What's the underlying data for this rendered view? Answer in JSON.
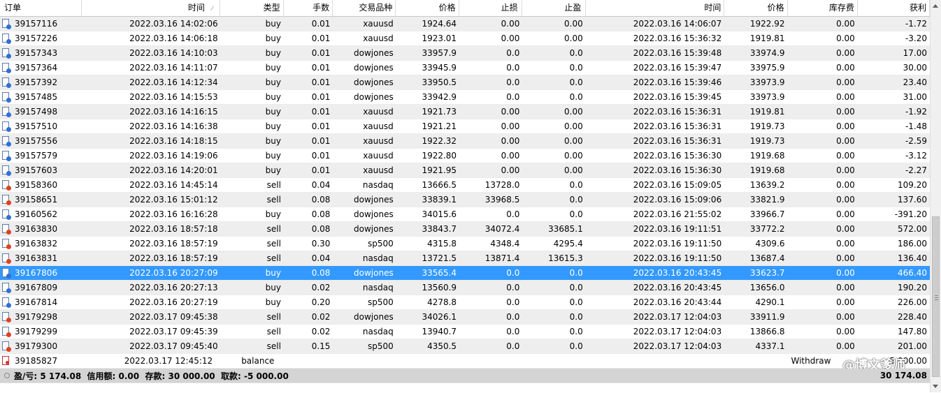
{
  "columns": {
    "order": "订单",
    "time": "时间",
    "type": "类型",
    "lots": "手数",
    "symbol": "交易品种",
    "price": "价格",
    "sl": "止损",
    "tp": "止盈",
    "close_time": "时间",
    "close_price": "价格",
    "swap": "库存费",
    "profit": "获利"
  },
  "rows": [
    {
      "order": "39157116",
      "time": "2022.03.16 14:02:06",
      "type": "buy",
      "lots": "0.01",
      "symbol": "xauusd",
      "price": "1924.64",
      "sl": "0.00",
      "tp": "0.00",
      "close_time": "2022.03.16 14:06:07",
      "close_price": "1922.92",
      "swap": "0.00",
      "profit": "-1.72"
    },
    {
      "order": "39157226",
      "time": "2022.03.16 14:06:18",
      "type": "buy",
      "lots": "0.01",
      "symbol": "xauusd",
      "price": "1923.01",
      "sl": "0.00",
      "tp": "0.00",
      "close_time": "2022.03.16 15:36:32",
      "close_price": "1919.81",
      "swap": "0.00",
      "profit": "-3.20"
    },
    {
      "order": "39157343",
      "time": "2022.03.16 14:10:03",
      "type": "buy",
      "lots": "0.01",
      "symbol": "dowjones",
      "price": "33957.9",
      "sl": "0.0",
      "tp": "0.0",
      "close_time": "2022.03.16 15:39:48",
      "close_price": "33974.9",
      "swap": "0.00",
      "profit": "17.00"
    },
    {
      "order": "39157364",
      "time": "2022.03.16 14:11:07",
      "type": "buy",
      "lots": "0.01",
      "symbol": "dowjones",
      "price": "33945.9",
      "sl": "0.0",
      "tp": "0.0",
      "close_time": "2022.03.16 15:39:47",
      "close_price": "33975.9",
      "swap": "0.00",
      "profit": "30.00"
    },
    {
      "order": "39157392",
      "time": "2022.03.16 14:12:34",
      "type": "buy",
      "lots": "0.01",
      "symbol": "dowjones",
      "price": "33950.5",
      "sl": "0.0",
      "tp": "0.0",
      "close_time": "2022.03.16 15:39:46",
      "close_price": "33973.9",
      "swap": "0.00",
      "profit": "23.40"
    },
    {
      "order": "39157485",
      "time": "2022.03.16 14:15:53",
      "type": "buy",
      "lots": "0.01",
      "symbol": "dowjones",
      "price": "33942.9",
      "sl": "0.0",
      "tp": "0.0",
      "close_time": "2022.03.16 15:39:45",
      "close_price": "33973.9",
      "swap": "0.00",
      "profit": "31.00"
    },
    {
      "order": "39157498",
      "time": "2022.03.16 14:16:15",
      "type": "buy",
      "lots": "0.01",
      "symbol": "xauusd",
      "price": "1921.73",
      "sl": "0.00",
      "tp": "0.00",
      "close_time": "2022.03.16 15:36:31",
      "close_price": "1919.81",
      "swap": "0.00",
      "profit": "-1.92"
    },
    {
      "order": "39157510",
      "time": "2022.03.16 14:16:38",
      "type": "buy",
      "lots": "0.01",
      "symbol": "xauusd",
      "price": "1921.21",
      "sl": "0.00",
      "tp": "0.00",
      "close_time": "2022.03.16 15:36:31",
      "close_price": "1919.73",
      "swap": "0.00",
      "profit": "-1.48"
    },
    {
      "order": "39157556",
      "time": "2022.03.16 14:18:15",
      "type": "buy",
      "lots": "0.01",
      "symbol": "xauusd",
      "price": "1922.32",
      "sl": "0.00",
      "tp": "0.00",
      "close_time": "2022.03.16 15:36:31",
      "close_price": "1919.73",
      "swap": "0.00",
      "profit": "-2.59"
    },
    {
      "order": "39157579",
      "time": "2022.03.16 14:19:06",
      "type": "buy",
      "lots": "0.01",
      "symbol": "xauusd",
      "price": "1922.80",
      "sl": "0.00",
      "tp": "0.00",
      "close_time": "2022.03.16 15:36:30",
      "close_price": "1919.68",
      "swap": "0.00",
      "profit": "-3.12"
    },
    {
      "order": "39157603",
      "time": "2022.03.16 14:20:01",
      "type": "buy",
      "lots": "0.01",
      "symbol": "xauusd",
      "price": "1921.95",
      "sl": "0.00",
      "tp": "0.00",
      "close_time": "2022.03.16 15:36:30",
      "close_price": "1919.68",
      "swap": "0.00",
      "profit": "-2.27"
    },
    {
      "order": "39158360",
      "time": "2022.03.16 14:45:14",
      "type": "sell",
      "lots": "0.04",
      "symbol": "nasdaq",
      "price": "13666.5",
      "sl": "13728.0",
      "tp": "0.0",
      "close_time": "2022.03.16 15:09:05",
      "close_price": "13639.2",
      "swap": "0.00",
      "profit": "109.20"
    },
    {
      "order": "39158651",
      "time": "2022.03.16 15:01:12",
      "type": "sell",
      "lots": "0.08",
      "symbol": "dowjones",
      "price": "33839.1",
      "sl": "33968.5",
      "tp": "0.0",
      "close_time": "2022.03.16 15:09:06",
      "close_price": "33821.9",
      "swap": "0.00",
      "profit": "137.60"
    },
    {
      "order": "39160562",
      "time": "2022.03.16 16:16:28",
      "type": "buy",
      "lots": "0.08",
      "symbol": "dowjones",
      "price": "34015.6",
      "sl": "0.0",
      "tp": "0.0",
      "close_time": "2022.03.16 21:55:02",
      "close_price": "33966.7",
      "swap": "0.00",
      "profit": "-391.20"
    },
    {
      "order": "39163830",
      "time": "2022.03.16 18:57:18",
      "type": "sell",
      "lots": "0.08",
      "symbol": "dowjones",
      "price": "33843.7",
      "sl": "34072.4",
      "tp": "33685.1",
      "close_time": "2022.03.16 19:11:51",
      "close_price": "33772.2",
      "swap": "0.00",
      "profit": "572.00"
    },
    {
      "order": "39163832",
      "time": "2022.03.16 18:57:19",
      "type": "sell",
      "lots": "0.30",
      "symbol": "sp500",
      "price": "4315.8",
      "sl": "4348.4",
      "tp": "4295.4",
      "close_time": "2022.03.16 19:11:50",
      "close_price": "4309.6",
      "swap": "0.00",
      "profit": "186.00"
    },
    {
      "order": "39163831",
      "time": "2022.03.16 18:57:19",
      "type": "sell",
      "lots": "0.04",
      "symbol": "nasdaq",
      "price": "13721.5",
      "sl": "13871.4",
      "tp": "13615.3",
      "close_time": "2022.03.16 19:11:50",
      "close_price": "13687.4",
      "swap": "0.00",
      "profit": "136.40"
    },
    {
      "order": "39167806",
      "time": "2022.03.16 20:27:09",
      "type": "buy",
      "lots": "0.08",
      "symbol": "dowjones",
      "price": "33565.4",
      "sl": "0.0",
      "tp": "0.0",
      "close_time": "2022.03.16 20:43:45",
      "close_price": "33623.7",
      "swap": "0.00",
      "profit": "466.40"
    },
    {
      "order": "39167809",
      "time": "2022.03.16 20:27:13",
      "type": "buy",
      "lots": "0.02",
      "symbol": "nasdaq",
      "price": "13560.9",
      "sl": "0.0",
      "tp": "0.0",
      "close_time": "2022.03.16 20:43:45",
      "close_price": "13656.0",
      "swap": "0.00",
      "profit": "190.20"
    },
    {
      "order": "39167814",
      "time": "2022.03.16 20:27:19",
      "type": "buy",
      "lots": "0.20",
      "symbol": "sp500",
      "price": "4278.8",
      "sl": "0.0",
      "tp": "0.0",
      "close_time": "2022.03.16 20:43:44",
      "close_price": "4290.1",
      "swap": "0.00",
      "profit": "226.00"
    },
    {
      "order": "39179298",
      "time": "2022.03.17 09:45:38",
      "type": "sell",
      "lots": "0.02",
      "symbol": "dowjones",
      "price": "34026.1",
      "sl": "0.0",
      "tp": "0.0",
      "close_time": "2022.03.17 12:04:03",
      "close_price": "33911.9",
      "swap": "0.00",
      "profit": "228.40"
    },
    {
      "order": "39179299",
      "time": "2022.03.17 09:45:39",
      "type": "sell",
      "lots": "0.02",
      "symbol": "nasdaq",
      "price": "13940.7",
      "sl": "0.0",
      "tp": "0.0",
      "close_time": "2022.03.17 12:04:03",
      "close_price": "13866.8",
      "swap": "0.00",
      "profit": "147.80"
    },
    {
      "order": "39179300",
      "time": "2022.03.17 09:45:40",
      "type": "sell",
      "lots": "0.15",
      "symbol": "sp500",
      "price": "4350.5",
      "sl": "0.0",
      "tp": "0.0",
      "close_time": "2022.03.17 12:04:03",
      "close_price": "4337.1",
      "swap": "0.00",
      "profit": "201.00"
    }
  ],
  "selected_order": "39167806",
  "balance_row": {
    "order": "39185827",
    "time": "2022.03.17 12:45:12",
    "type": "balance",
    "comment": "Withdraw",
    "profit": "-5 000.00"
  },
  "footer": {
    "summary": "盈/亏: 5 174.08  信用额: 0.00  存款: 30 000.00  取款: -5 000.00",
    "total": "30 174.08"
  },
  "watermark": "@博文爹师",
  "colors": {
    "selected_row": "#3399ff",
    "alt_row": "#eeeeee",
    "footer_bg": "#d4d4d4",
    "buy_icon": "#2f6fd6",
    "sell_icon": "#e04020"
  }
}
